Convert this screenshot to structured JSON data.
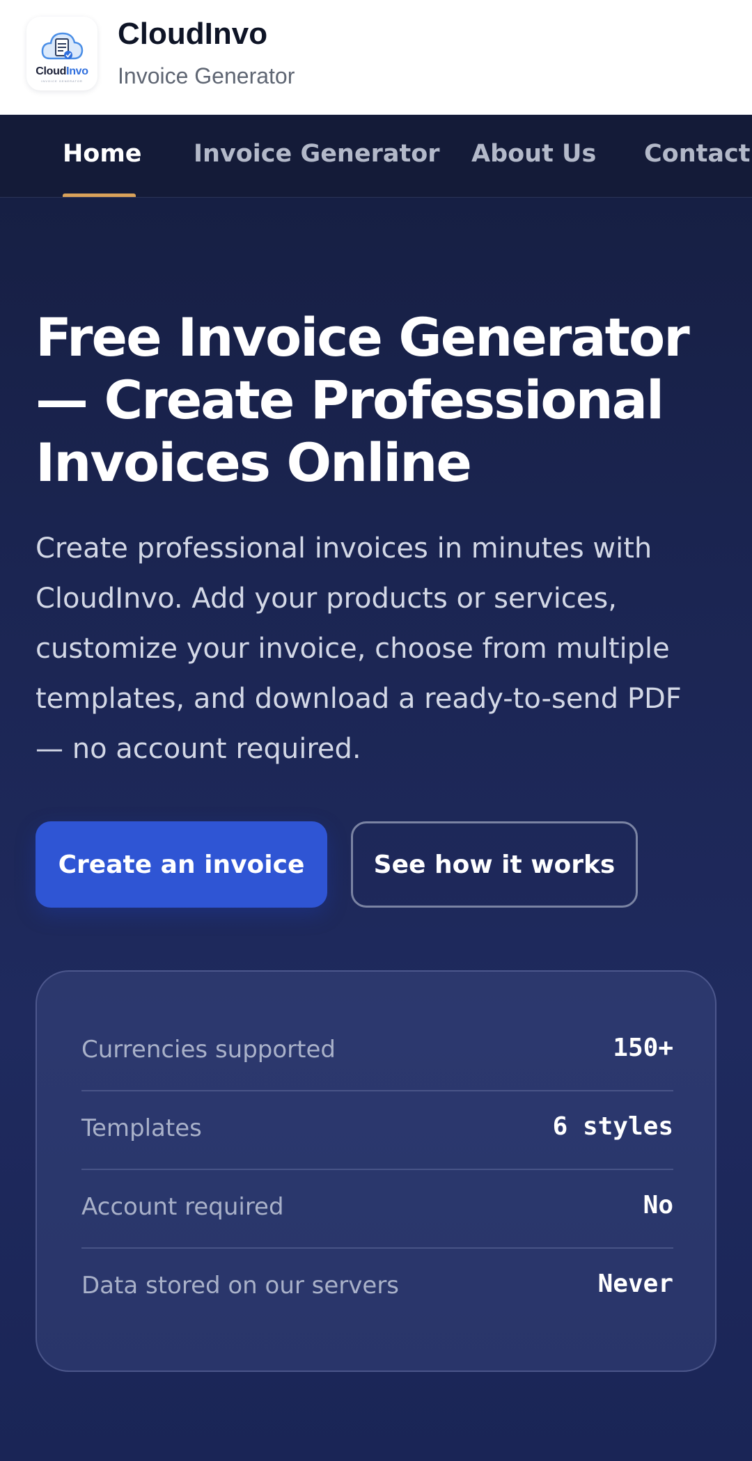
{
  "header": {
    "logo_text_main": "Cloud",
    "logo_text_accent": "Invo",
    "logo_tagline": "INVOICE GENERATOR",
    "brand_name": "CloudInvo",
    "brand_subtitle": "Invoice Generator",
    "logo_icon": "cloud-invoice-icon"
  },
  "nav": {
    "items": [
      {
        "label": "Home",
        "active": true
      },
      {
        "label": "Invoice Generator",
        "active": false
      },
      {
        "label": "About Us",
        "active": false
      },
      {
        "label": "Contact",
        "active": false
      }
    ],
    "active_underline_color": "#d9a25a"
  },
  "hero": {
    "title_lines": [
      "Free Invoice Generator",
      "— Create Professional",
      "Invoices Online"
    ],
    "description_lines": [
      "Create professional invoices in minutes with",
      "CloudInvo. Add your products or services,",
      "customize your invoice, choose from multiple",
      "templates, and download a ready-to-send PDF",
      "— no account required."
    ],
    "primary_button": "Create an invoice",
    "secondary_button": "See how it works"
  },
  "stats": [
    {
      "label": "Currencies supported",
      "value": "150+"
    },
    {
      "label": "Templates",
      "value": "6 styles"
    },
    {
      "label": "Account required",
      "value": "No"
    },
    {
      "label": "Data stored on our servers",
      "value": "Never"
    }
  ],
  "colors": {
    "primary": "#2f55d4",
    "background": "#1b2552",
    "accent": "#d9a25a"
  }
}
